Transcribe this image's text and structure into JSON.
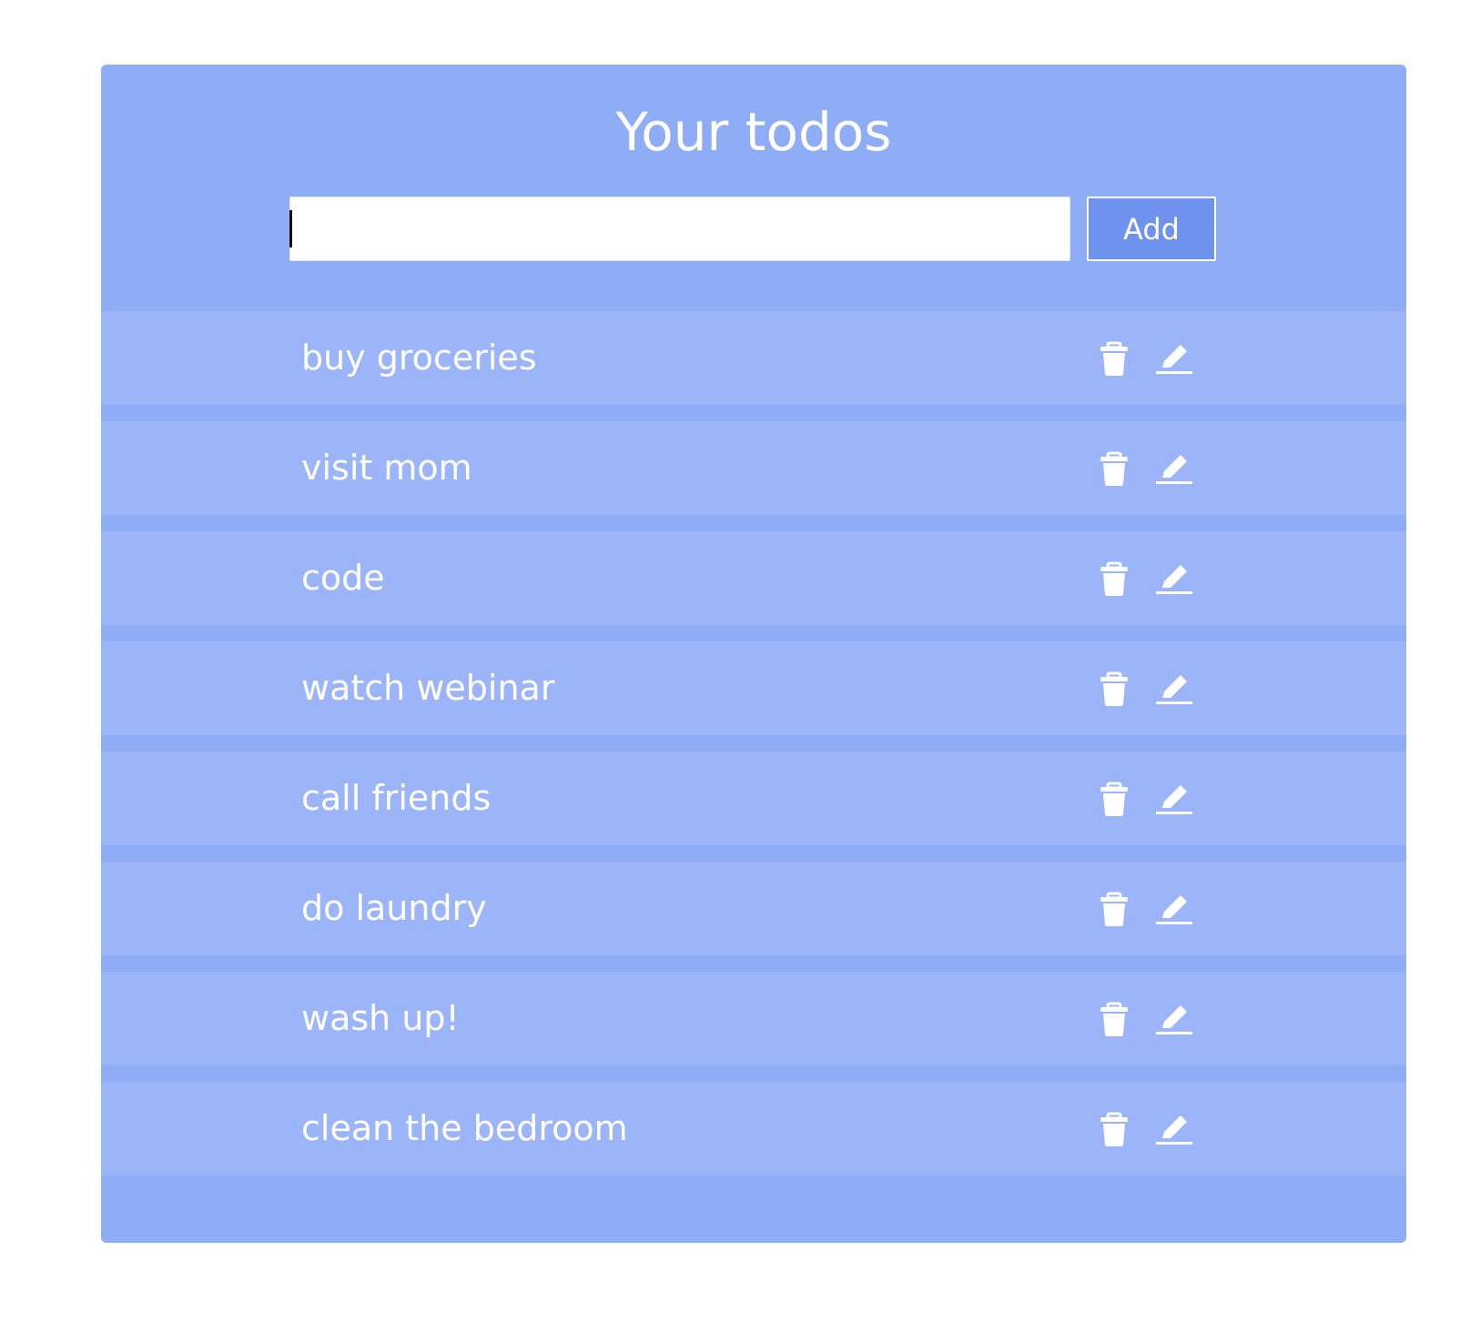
{
  "header": {
    "title": "Your todos"
  },
  "form": {
    "input_value": "",
    "add_label": "Add"
  },
  "todos": [
    {
      "text": "buy groceries"
    },
    {
      "text": "visit mom"
    },
    {
      "text": "code"
    },
    {
      "text": "watch webinar"
    },
    {
      "text": "call friends"
    },
    {
      "text": "do laundry"
    },
    {
      "text": "wash up!"
    },
    {
      "text": "clean the bedroom"
    }
  ],
  "icons": {
    "delete": "trash-icon",
    "edit": "pencil-icon"
  },
  "colors": {
    "card_background": "#8fadf6",
    "item_background": "#9cb5f8",
    "button_background": "#6f92ee",
    "text": "#ffffff"
  }
}
